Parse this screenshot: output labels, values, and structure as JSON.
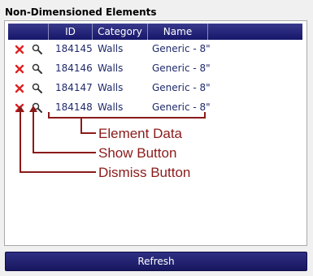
{
  "panel": {
    "title": "Non-Dimensioned Elements"
  },
  "grid": {
    "columns": [
      "ID",
      "Category",
      "Name"
    ],
    "rows": [
      {
        "id": "184145",
        "category": "Walls",
        "name": "Generic - 8\""
      },
      {
        "id": "184146",
        "category": "Walls",
        "name": "Generic - 8\""
      },
      {
        "id": "184147",
        "category": "Walls",
        "name": "Generic - 8\""
      },
      {
        "id": "184148",
        "category": "Walls",
        "name": "Generic - 8\""
      }
    ],
    "dismiss_icon": "close-x-icon",
    "show_icon": "magnifier-icon"
  },
  "annotations": {
    "element_data": "Element Data",
    "show_button": "Show Button",
    "dismiss_button": "Dismiss Button"
  },
  "refresh_label": "Refresh",
  "colors": {
    "header_bg": "#1e1e74",
    "annotation": "#8b1a1a",
    "dismiss_x": "#e02020",
    "cell_text": "#1f2a6b"
  }
}
